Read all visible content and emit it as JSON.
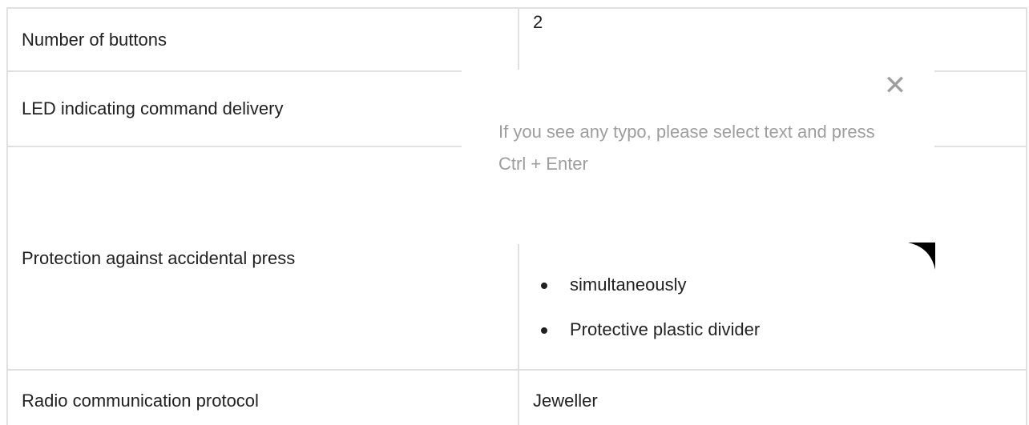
{
  "specs": {
    "rows": [
      {
        "label": "Number of buttons",
        "value": "2"
      },
      {
        "label": "LED indicating command delivery",
        "value": ""
      },
      {
        "label": "Protection against accidental press",
        "bullets": [
          "simultaneously",
          "Protective plastic divider"
        ]
      },
      {
        "label": "Radio communication protocol",
        "value": "Jeweller"
      }
    ]
  },
  "popup": {
    "message": "If you see any typo, please select text and press Ctrl + Enter",
    "close_glyph": "✕"
  },
  "icons": {
    "close": "close-icon",
    "bullet": "bullet-dot"
  },
  "colors": {
    "text": "#212121",
    "muted": "#9e9e9e",
    "border": "#e0e0e0"
  }
}
